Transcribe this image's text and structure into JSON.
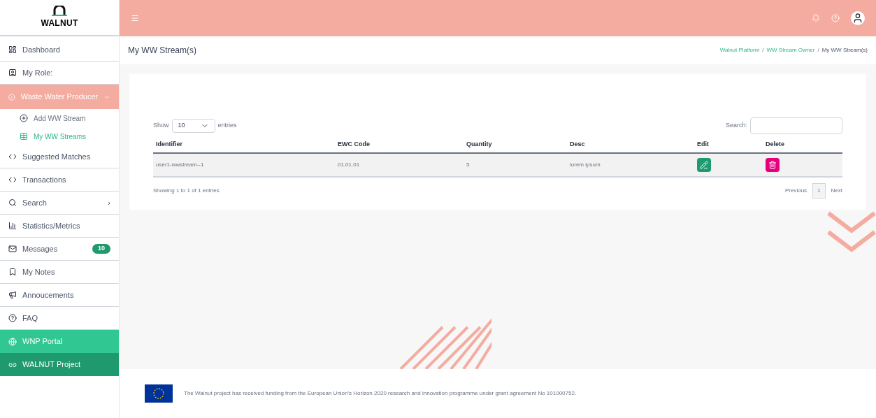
{
  "logo": {
    "text": "WALNUT"
  },
  "sidebar": {
    "items": [
      {
        "kind": "item",
        "label": "Dashboard"
      },
      {
        "kind": "item",
        "label": "My Role:"
      },
      {
        "kind": "group",
        "label": "Waste Water Producer",
        "expanded": true,
        "children": [
          {
            "label": "Add WW Stream",
            "selected": false
          },
          {
            "label": "My WW Streams",
            "selected": true
          }
        ]
      },
      {
        "kind": "item",
        "label": "Suggested Matches"
      },
      {
        "kind": "item",
        "label": "Transactions"
      },
      {
        "kind": "item",
        "label": "Search",
        "arrow": "›"
      },
      {
        "kind": "item",
        "label": "Statistics/Metrics"
      },
      {
        "kind": "item",
        "label": "Messages",
        "badge": "10"
      },
      {
        "kind": "item",
        "label": "My Notes"
      },
      {
        "kind": "item",
        "label": "Annoucements"
      },
      {
        "kind": "item",
        "label": "FAQ"
      },
      {
        "kind": "portal",
        "label": "WNP Portal"
      },
      {
        "kind": "project",
        "label": "WALNUT Project"
      }
    ]
  },
  "page": {
    "title": "My WW Stream(s)",
    "breadcrumb": [
      {
        "kind": "link",
        "label": "Walnut Platform"
      },
      {
        "kind": "separator",
        "label": "/"
      },
      {
        "kind": "link",
        "label": "WW Stream Owner"
      },
      {
        "kind": "separator",
        "label": "/"
      },
      {
        "kind": "current",
        "label": "My WW Stream(s)"
      }
    ]
  },
  "table_controls": {
    "show_label": "Show",
    "page_size": "10",
    "entries_label": "entries",
    "search_label": "Search:"
  },
  "table": {
    "columns": [
      "Identifier",
      "EWC Code",
      "Quantity",
      "Desc",
      "Edit",
      "Delete"
    ],
    "rows": [
      {
        "identifier": "user1-wwstream--1",
        "ewc_code": "01.01.01",
        "quantity": "5",
        "desc": "lorem ipsum"
      }
    ]
  },
  "footer_table": {
    "info": "Showing 1 to 1 of 1 entries",
    "previous": "Previous",
    "pages": [
      {
        "label": "1",
        "selected": true
      }
    ],
    "next": "Next"
  },
  "footer": {
    "text": "The Walnut project has received funding from the European Union's Horizon 2020 research and innovation programme under grant agreement No 101000752."
  }
}
